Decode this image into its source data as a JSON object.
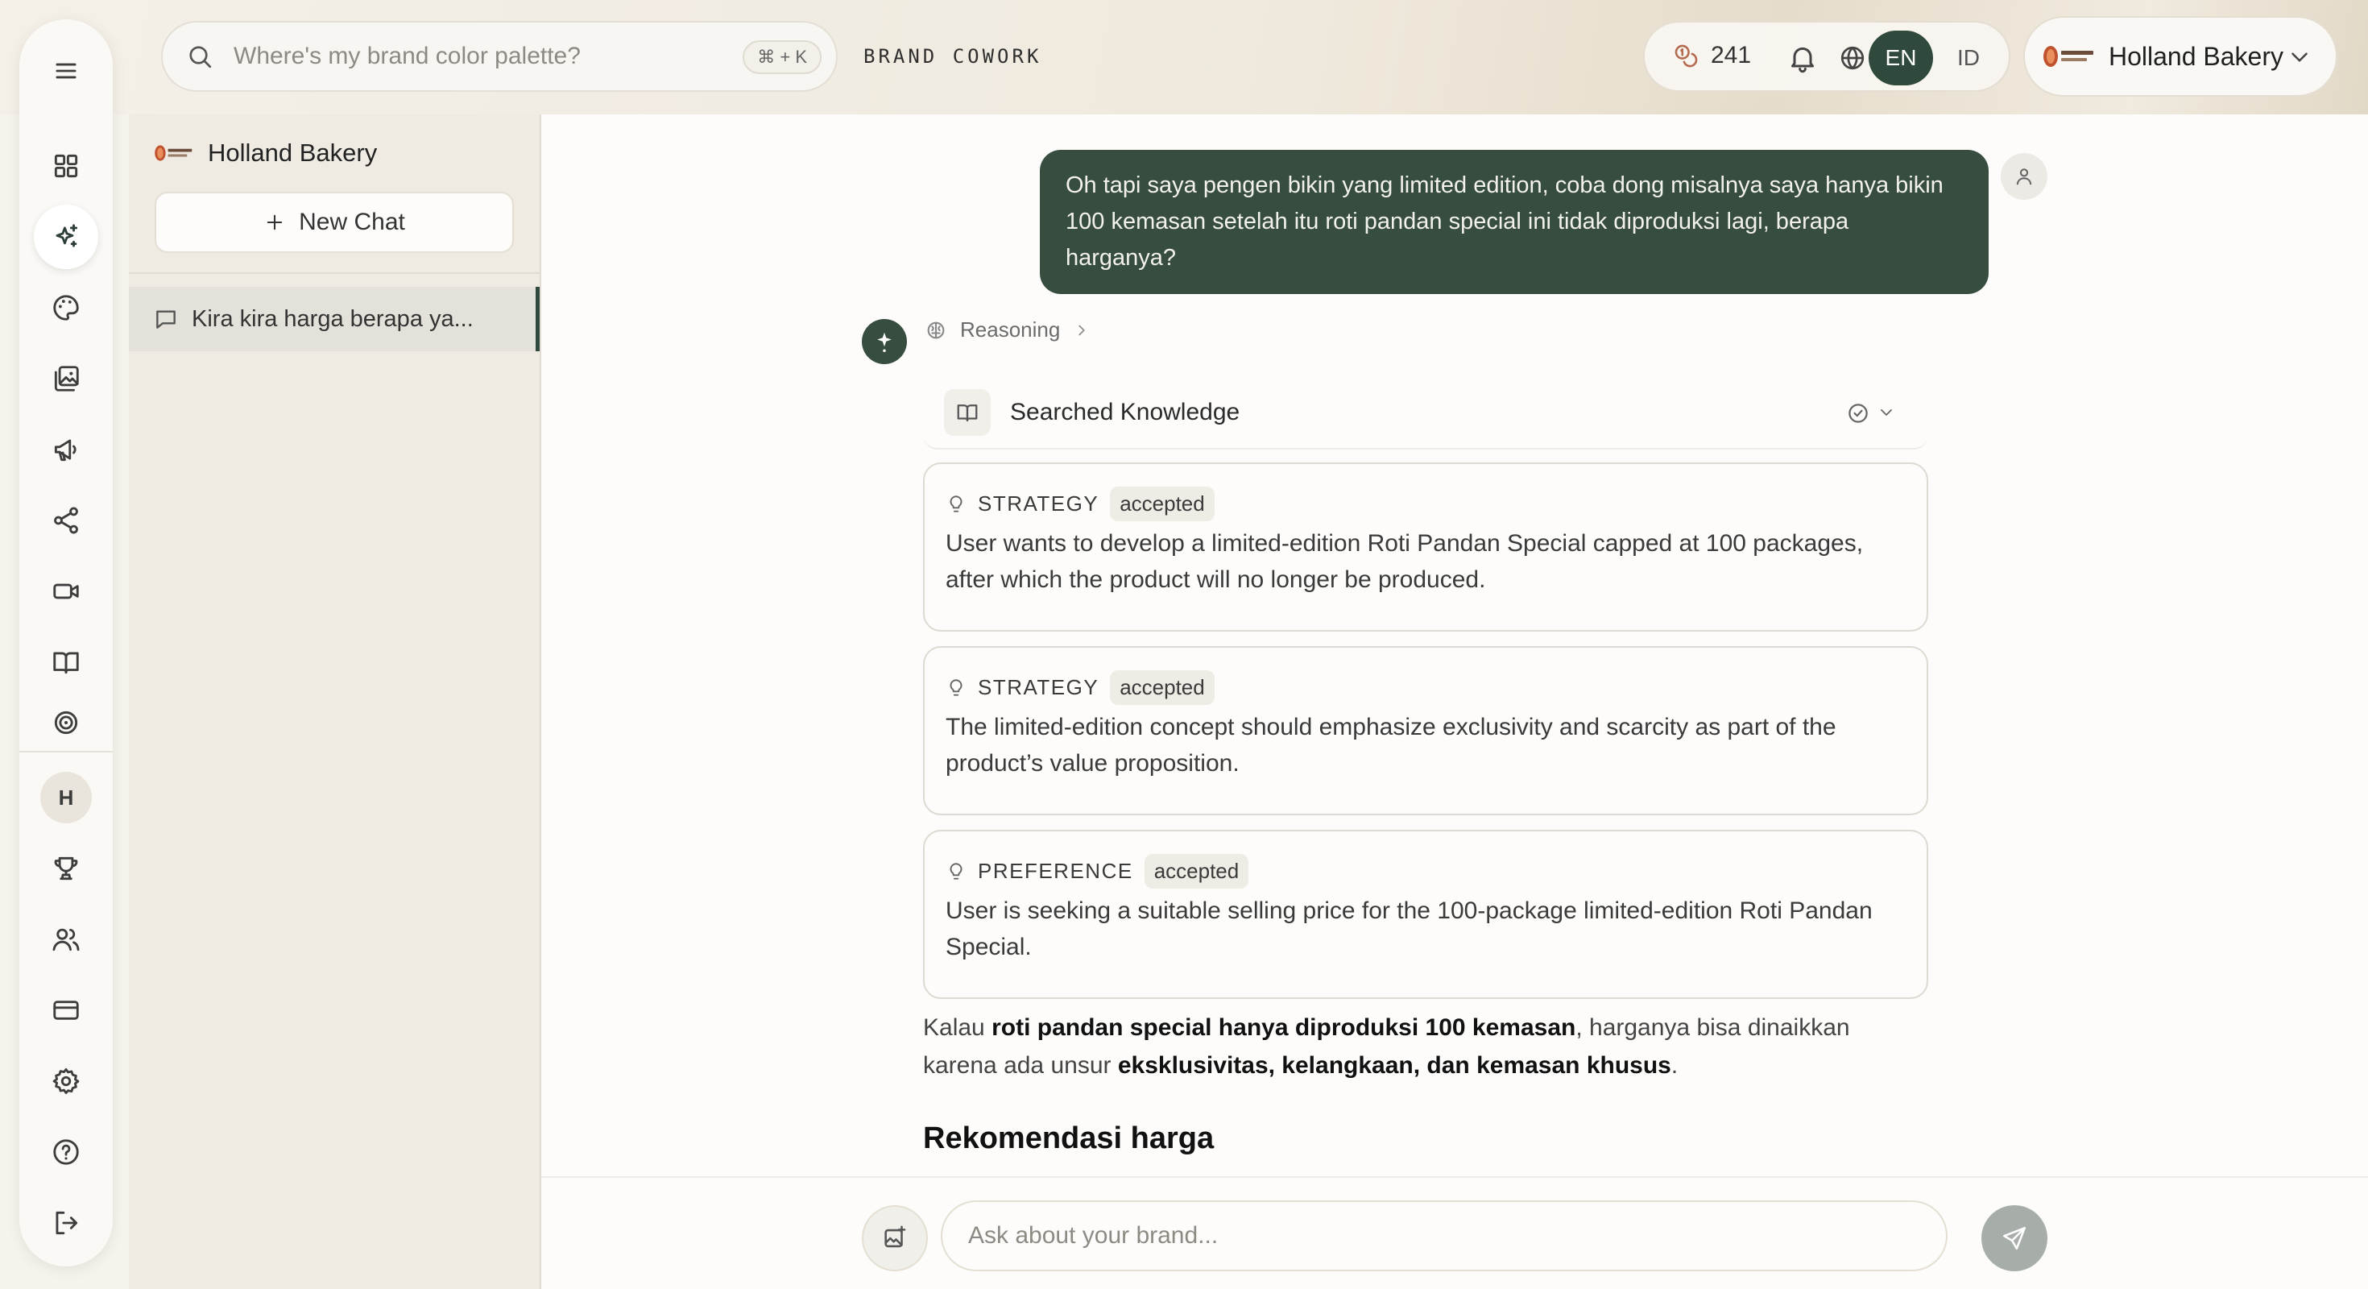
{
  "header": {
    "search_placeholder": "Where's my brand color palette?",
    "search_shortcut": "⌘ + K",
    "brand_label": "BRAND COWORK",
    "credits": "241",
    "languages": [
      "EN",
      "ID"
    ],
    "active_language": "EN",
    "account_name": "Holland Bakery"
  },
  "rail": {
    "items": [
      "menu-icon",
      "dashboard-icon",
      "ai-sparkle-icon",
      "palette-icon",
      "images-icon",
      "megaphone-icon",
      "share-icon",
      "video-icon",
      "book-icon",
      "target-icon"
    ],
    "active": "ai-sparkle-icon",
    "avatar_initial": "H",
    "bottom_items": [
      "trophy-icon",
      "users-icon",
      "card-icon",
      "gear-icon",
      "help-icon",
      "logout-icon"
    ]
  },
  "sidebar": {
    "brand_name": "Holland Bakery",
    "new_chat_label": "New Chat",
    "chats": [
      {
        "title": "Kira kira harga berapa ya..."
      }
    ]
  },
  "conversation": {
    "user_message": "Oh tapi saya pengen bikin yang limited edition, coba dong misalnya saya hanya bikin 100 kemasan setelah itu roti pandan special ini tidak diproduksi lagi, berapa harganya?",
    "reasoning_label": "Reasoning",
    "searched_label": "Searched Knowledge",
    "knowledge": [
      {
        "type": "STRATEGY",
        "status": "accepted",
        "text": "User wants to develop a limited-edition Roti Pandan Special capped at 100 packages, after which the product will no longer be produced."
      },
      {
        "type": "STRATEGY",
        "status": "accepted",
        "text": "The limited-edition concept should emphasize exclusivity and scarcity as part of the product’s value proposition."
      },
      {
        "type": "PREFERENCE",
        "status": "accepted",
        "text": "User is seeking a suitable selling price for the 100-package limited-edition Roti Pandan Special."
      }
    ],
    "answer": {
      "p1": "Kalau ",
      "b1": "roti pandan special hanya diproduksi 100 kemasan",
      "p2": ", harganya bisa dinaikkan karena ada unsur ",
      "b2": "eksklusivitas, kelangkaan, dan kemasan khusus",
      "p3": "."
    },
    "section_heading": "Rekomendasi harga"
  },
  "composer": {
    "placeholder": "Ask about your brand..."
  },
  "colors": {
    "accent": "#364d40",
    "background": "#fdfcfa",
    "sidebar": "#efebe2"
  }
}
